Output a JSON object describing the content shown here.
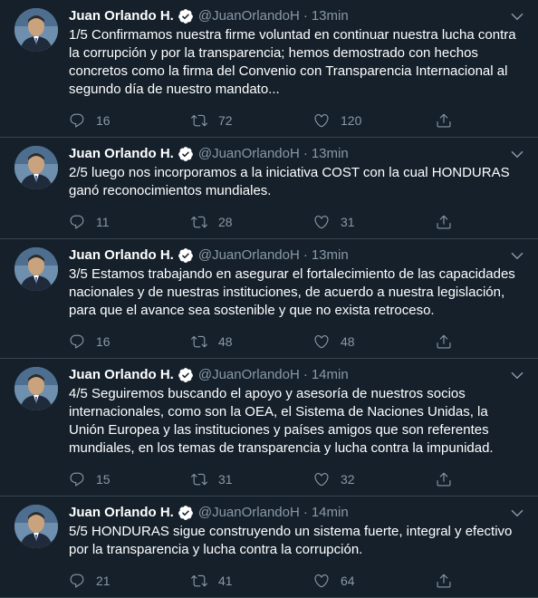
{
  "author": {
    "name": "Juan Orlando H.",
    "handle": "@JuanOrlandoH"
  },
  "icons": {
    "reply": "reply-icon",
    "retweet": "retweet-icon",
    "like": "heart-icon",
    "share": "share-icon",
    "menu": "chevron-down-icon",
    "verified": "verified-badge-icon"
  },
  "colors": {
    "background": "#15202b",
    "text": "#ffffff",
    "muted": "#8899a6",
    "border": "#38444d",
    "verified": "#ffffff"
  },
  "dot": "·",
  "tweets": [
    {
      "time": "13min",
      "text": "1/5 Confirmamos nuestra firme voluntad en continuar nuestra lucha contra la corrupción y por la transparencia; hemos demostrado con hechos concretos como la firma del Convenio con Transparencia Internacional al segundo día de nuestro mandato...",
      "replies": "16",
      "retweets": "72",
      "likes": "120"
    },
    {
      "time": "13min",
      "text": "2/5 luego nos incorporamos a la iniciativa COST con la cual HONDURAS ganó reconocimientos mundiales.",
      "replies": "11",
      "retweets": "28",
      "likes": "31"
    },
    {
      "time": "13min",
      "text": "3/5 Estamos trabajando en asegurar el fortalecimiento de las capacidades nacionales y de nuestras instituciones,  de acuerdo a nuestra legislación, para que el avance sea sostenible y que no exista retroceso.",
      "replies": "16",
      "retweets": "48",
      "likes": "48"
    },
    {
      "time": "14min",
      "text": "4/5 Seguiremos buscando el apoyo y asesoría de nuestros socios internacionales, como son la OEA, el Sistema de Naciones Unidas, la Unión Europea  y las instituciones y países amigos que son referentes mundiales, en los temas de transparencia y lucha contra la impunidad.",
      "replies": "15",
      "retweets": "31",
      "likes": "32"
    },
    {
      "time": "14min",
      "text": "5/5 HONDURAS sigue construyendo un sistema fuerte, integral y efectivo por la transparencia y lucha contra la corrupción.",
      "replies": "21",
      "retweets": "41",
      "likes": "64"
    }
  ]
}
